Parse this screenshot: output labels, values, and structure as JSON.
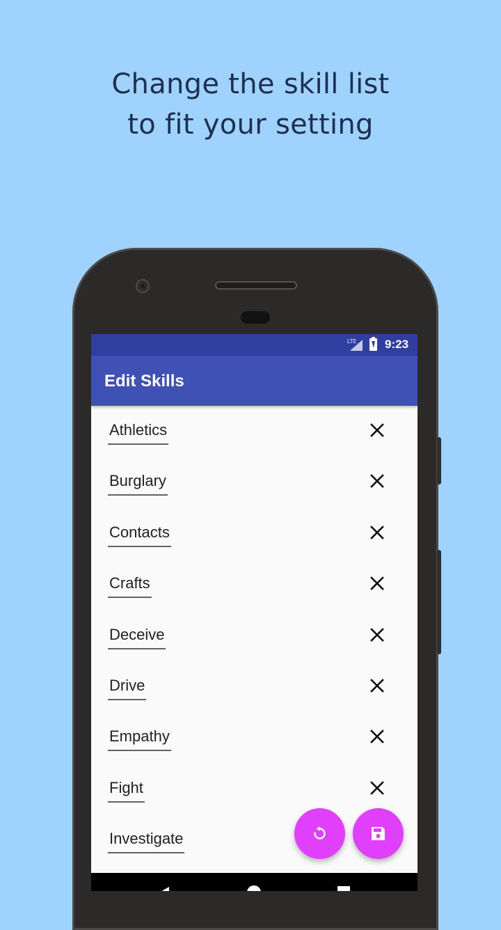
{
  "promo": {
    "line1": "Change the skill list",
    "line2": "to fit your setting"
  },
  "status_bar": {
    "network": "LTE",
    "time": "9:23"
  },
  "app_bar": {
    "title": "Edit Skills"
  },
  "skills": [
    {
      "label": "Athletics",
      "remove_icon": "close-icon"
    },
    {
      "label": "Burglary",
      "remove_icon": "close-icon"
    },
    {
      "label": "Contacts",
      "remove_icon": "close-icon"
    },
    {
      "label": "Crafts",
      "remove_icon": "close-icon"
    },
    {
      "label": "Deceive",
      "remove_icon": "close-icon"
    },
    {
      "label": "Drive",
      "remove_icon": "close-icon"
    },
    {
      "label": "Empathy",
      "remove_icon": "close-icon"
    },
    {
      "label": "Fight",
      "remove_icon": "close-icon"
    },
    {
      "label": "Investigate",
      "remove_icon": "close-icon"
    }
  ],
  "fabs": {
    "reset_icon": "reset-icon",
    "save_icon": "save-icon"
  },
  "colors": {
    "background": "#9fd2fc",
    "status_bar": "#303f9f",
    "app_bar": "#3f51b5",
    "fab": "#e040fb",
    "headline": "#1f2f4f"
  }
}
